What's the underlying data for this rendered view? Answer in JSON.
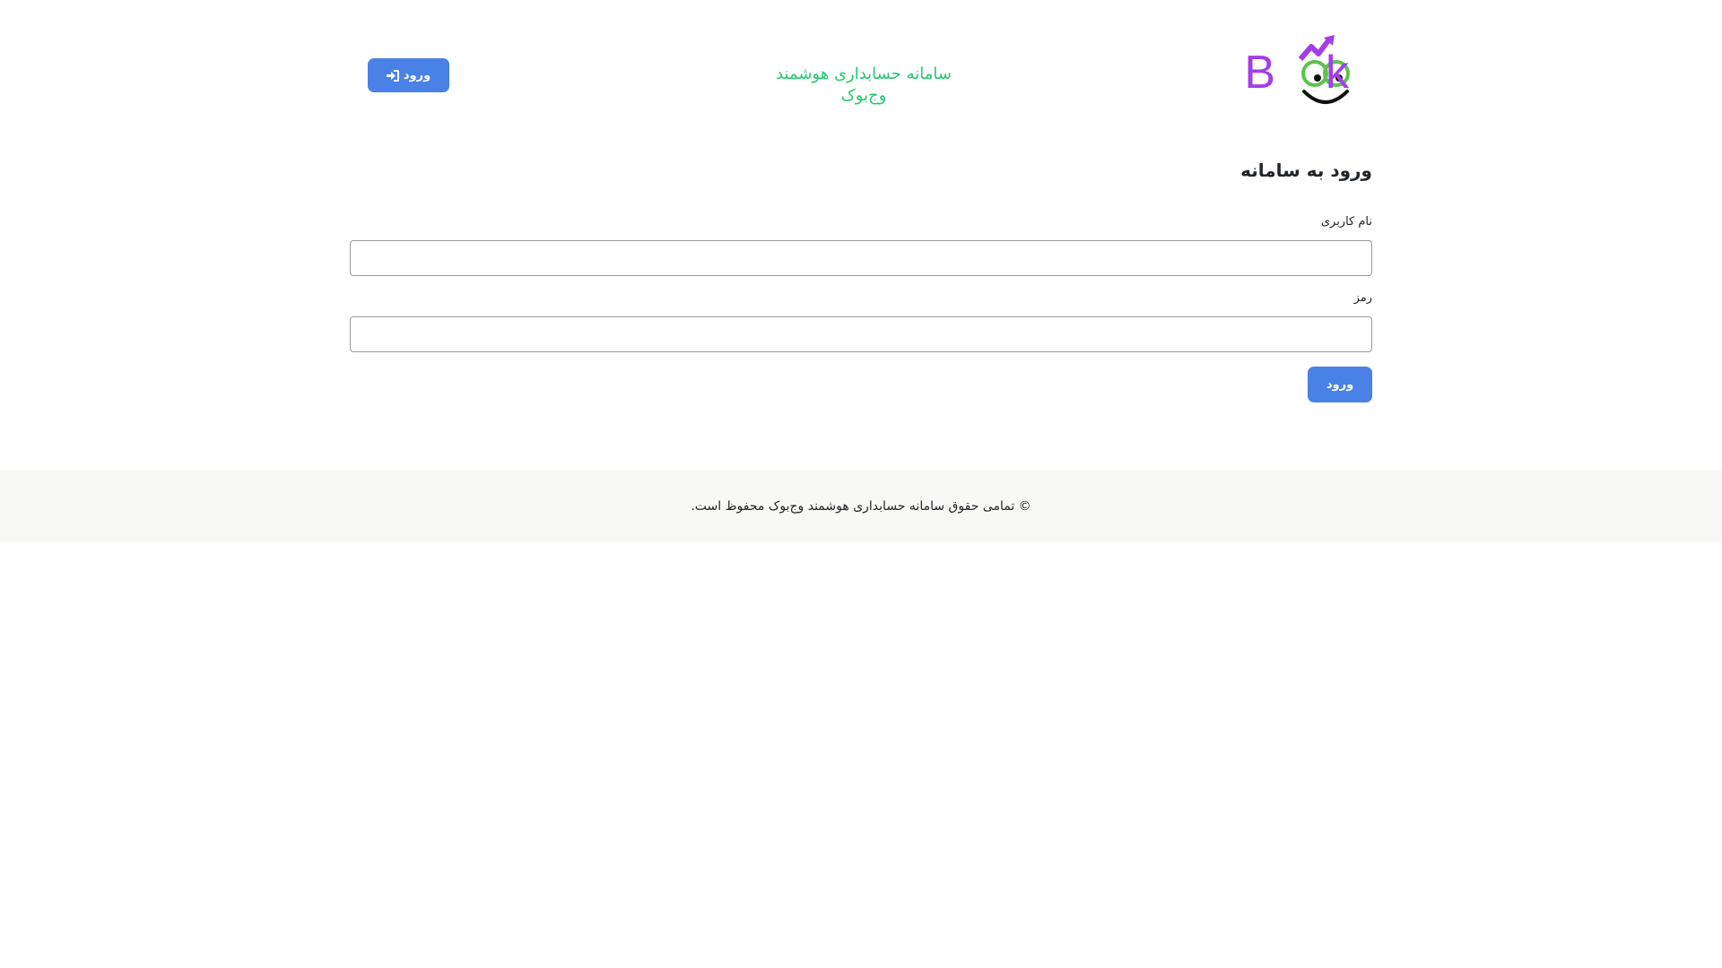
{
  "header": {
    "logo_text": "VegBook",
    "site_title": "سامانه حسابداری هوشمند وج‌بوک",
    "login_button": "ورود",
    "login_icon": "sign-in-icon"
  },
  "login_form": {
    "heading": "ورود به سامانه",
    "username_label": "نام کاربری",
    "username_value": "",
    "password_label": "رمز",
    "password_value": "",
    "submit_label": "ورود"
  },
  "footer": {
    "copyright": "© تمامی حقوق سامانه حسابداری هوشمند وج‌بوک محفوظ است."
  },
  "colors": {
    "brand_green": "#5ec24c",
    "brand_purple": "#a23ee8",
    "title_green": "#28c76f",
    "button_blue": "#4a81e6",
    "footer_bg": "#f8f9f6"
  }
}
